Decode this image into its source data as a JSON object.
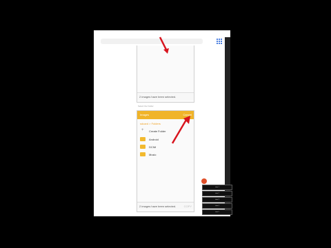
{
  "screen1": {
    "status": "2 images have been selected."
  },
  "screen2": {
    "app_title": "Images",
    "actions": "Cancel",
    "breadcrumb": "sdcard > Folders",
    "items": [
      "Create Folder",
      "Android",
      "DCIM",
      "Music"
    ],
    "status": "2 images have been selected.",
    "copy_label": "COPY"
  },
  "caption": "Select the Folder",
  "menu_items": [
    "item 1",
    "item 2",
    "item 3",
    "item 4",
    "item 5"
  ],
  "colors": {
    "accent": "#f0b429",
    "arrow": "#d8141e"
  }
}
